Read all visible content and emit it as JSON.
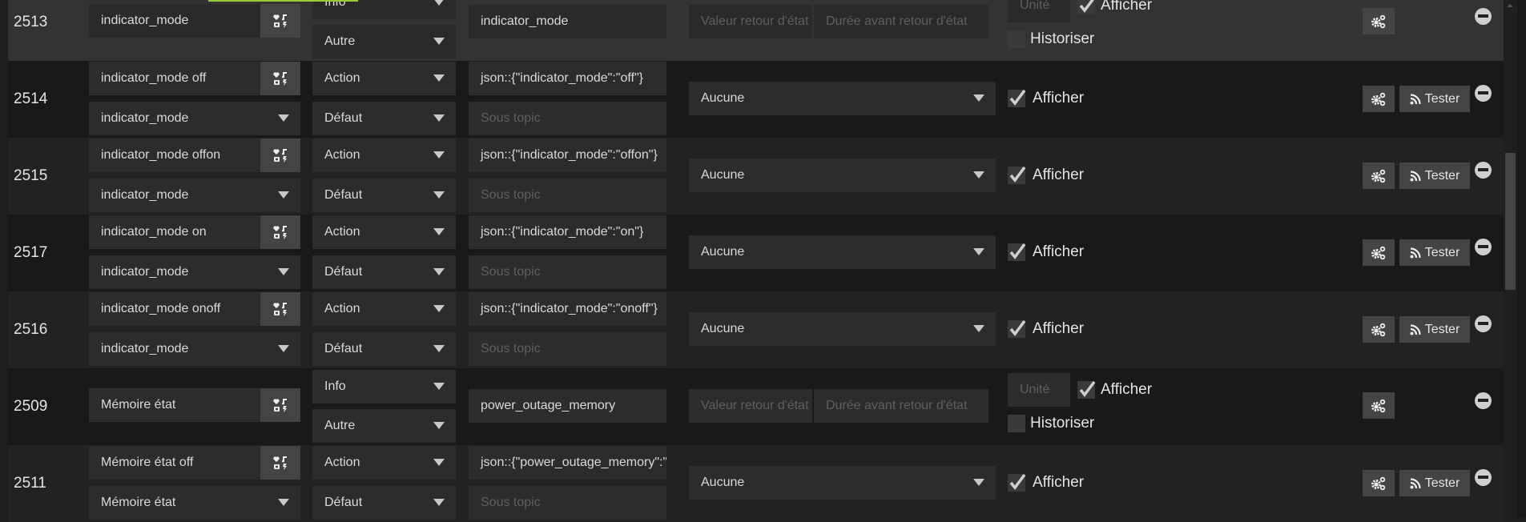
{
  "placeholders": {
    "valeur_retour": "Valeur retour d'état",
    "duree_retour": "Durée avant retour d'état",
    "unite": "Unité",
    "sous_topic": "Sous topic"
  },
  "labels": {
    "afficher": "Afficher",
    "historiser": "Historiser",
    "tester": "Tester"
  },
  "colors": {
    "accent_line": "#9acd32",
    "row_light": "#222222",
    "row_dark": "#191919",
    "row_hover": "#333333"
  },
  "rows": [
    {
      "id": "2513",
      "kind": "info",
      "name": "indicator_mode",
      "type": "Info",
      "subtype": "Autre",
      "logical_id": "indicator_mode",
      "afficher": true,
      "historiser": false
    },
    {
      "id": "2514",
      "kind": "action",
      "name": "indicator_mode off",
      "value_cmd": "indicator_mode",
      "type": "Action",
      "subtype": "Défaut",
      "logical_id": "json::{\"indicator_mode\":\"off\"}",
      "return_cmd": "Aucune",
      "afficher": true
    },
    {
      "id": "2515",
      "kind": "action",
      "name": "indicator_mode offon",
      "value_cmd": "indicator_mode",
      "type": "Action",
      "subtype": "Défaut",
      "logical_id": "json::{\"indicator_mode\":\"offon\"}",
      "return_cmd": "Aucune",
      "afficher": true
    },
    {
      "id": "2517",
      "kind": "action",
      "name": "indicator_mode on",
      "value_cmd": "indicator_mode",
      "type": "Action",
      "subtype": "Défaut",
      "logical_id": "json::{\"indicator_mode\":\"on\"}",
      "return_cmd": "Aucune",
      "afficher": true
    },
    {
      "id": "2516",
      "kind": "action",
      "name": "indicator_mode onoff",
      "value_cmd": "indicator_mode",
      "type": "Action",
      "subtype": "Défaut",
      "logical_id": "json::{\"indicator_mode\":\"onoff\"}",
      "return_cmd": "Aucune",
      "afficher": true
    },
    {
      "id": "2509",
      "kind": "info",
      "name": "Mémoire état",
      "type": "Info",
      "subtype": "Autre",
      "logical_id": "power_outage_memory",
      "afficher": true,
      "historiser": false
    },
    {
      "id": "2511",
      "kind": "action",
      "name": "Mémoire état off",
      "value_cmd": "Mémoire état",
      "type": "Action",
      "subtype": "Défaut",
      "logical_id": "json::{\"power_outage_memory\":\"off\"}",
      "return_cmd": "Aucune",
      "afficher": true
    }
  ]
}
